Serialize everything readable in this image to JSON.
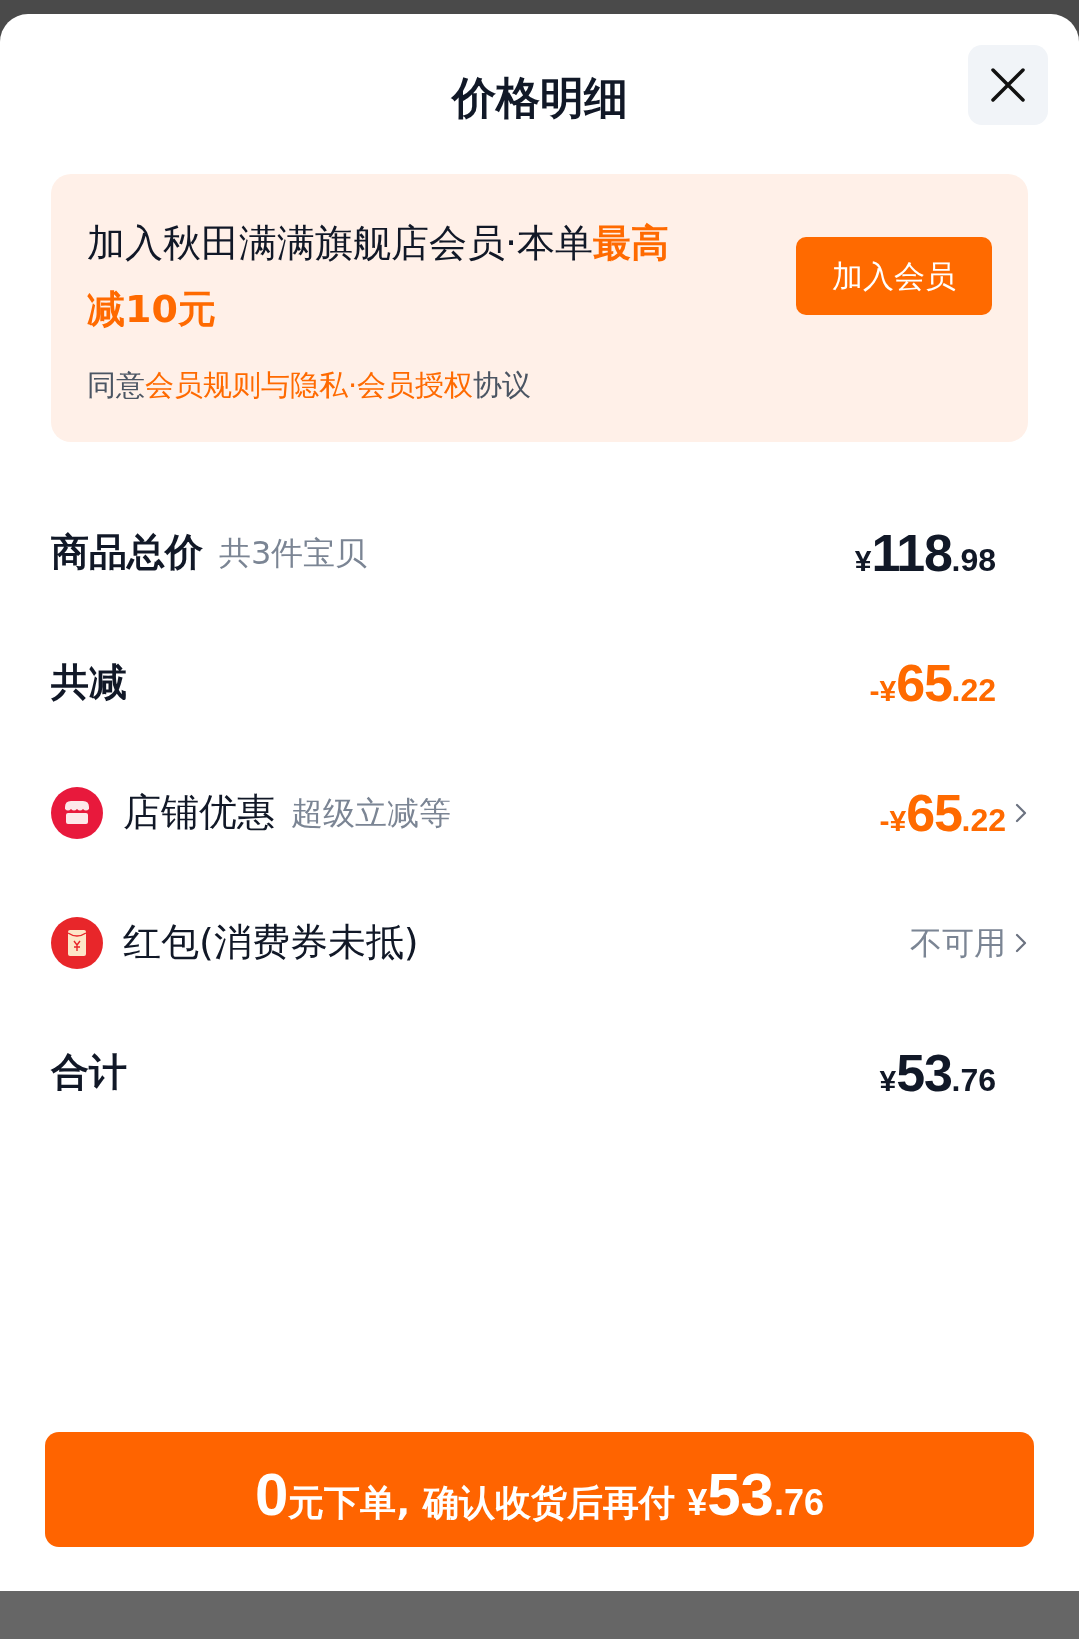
{
  "sheet": {
    "title": "价格明细"
  },
  "promo": {
    "text": "加入秋田满满旗舰店会员·本单",
    "highlight": "最高减10元",
    "button": "加入会员",
    "agree_before": "同意",
    "agree_link": "会员规则与隐私·会员授权",
    "agree_after": "协议"
  },
  "rows": [
    {
      "kind": "heading",
      "label": "商品总价",
      "note": "共3件宝贝",
      "price": {
        "sign": "¥",
        "main": "118",
        "fraction": ".98"
      },
      "discount": false,
      "chevron": false
    },
    {
      "kind": "heading",
      "label": "共减",
      "price": {
        "sign": "-¥",
        "main": "65",
        "fraction": ".22"
      },
      "discount": true,
      "chevron": false
    },
    {
      "kind": "shop",
      "label": "店铺优惠",
      "note": "超级立减等",
      "price": {
        "sign": "-¥",
        "main": "65",
        "fraction": ".22"
      },
      "discount": true,
      "chevron": true
    },
    {
      "kind": "redpacket",
      "label": "红包(消费券未抵)",
      "status": "不可用",
      "chevron": true
    },
    {
      "kind": "heading",
      "label": "合计",
      "price": {
        "sign": "¥",
        "main": "53",
        "fraction": ".76"
      },
      "discount": false,
      "chevron": false
    }
  ],
  "submit": {
    "parts": [
      {
        "kind": "big",
        "text": "0"
      },
      {
        "kind": "text",
        "text": "元下单, 确认收货后再付 "
      },
      {
        "kind": "small",
        "text": "¥"
      },
      {
        "kind": "big",
        "text": "53"
      },
      {
        "kind": "small",
        "text": ".76"
      }
    ]
  }
}
